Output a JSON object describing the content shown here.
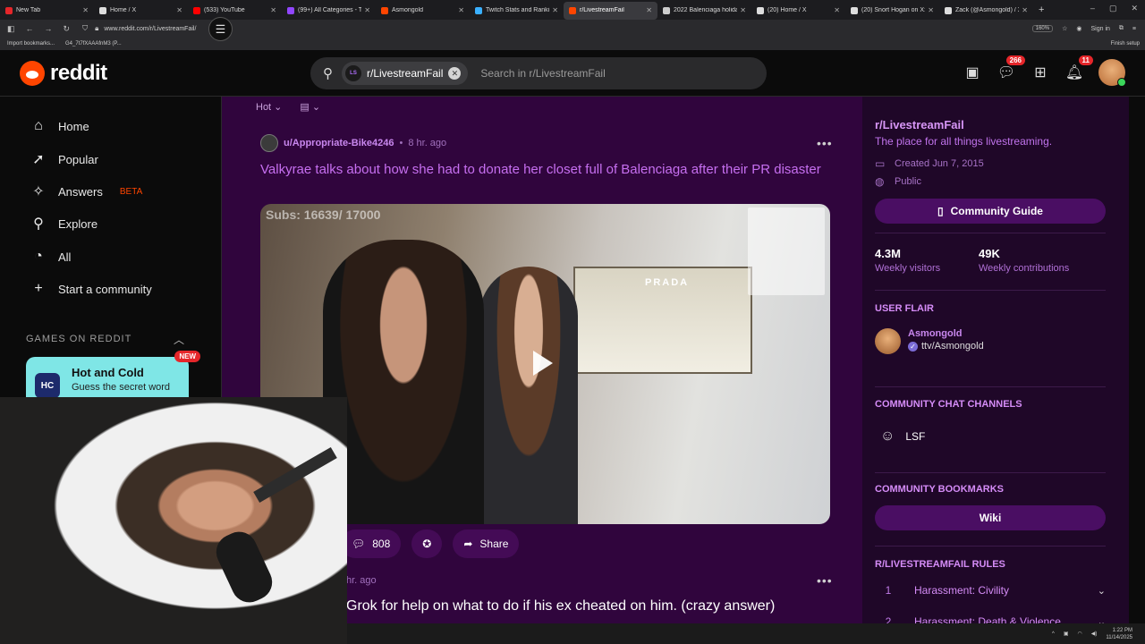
{
  "browser": {
    "tabs": [
      {
        "label": "New Tab",
        "color": "#e5262a"
      },
      {
        "label": "Home / X",
        "color": "#dddddd"
      },
      {
        "label": "(533) YouTube",
        "color": "#ff0000"
      },
      {
        "label": "(99+) All Categories - Twitch",
        "color": "#9146ff"
      },
      {
        "label": "Asmongold",
        "color": "#ff4500"
      },
      {
        "label": "Twitch Stats and Rankings",
        "color": "#3ab0ff"
      },
      {
        "label": "r/LivestreamFail",
        "color": "#ff4500",
        "active": true
      },
      {
        "label": "2022 Balenciaga holiday ad",
        "color": "#cccccc"
      },
      {
        "label": "(20) Home / X",
        "color": "#dddddd"
      },
      {
        "label": "(20) Snort Hogan on X: \"W",
        "color": "#dddddd"
      },
      {
        "label": "Zack (@Asmongold) / X",
        "color": "#dddddd"
      }
    ],
    "url": "www.reddit.com/r/LivestreamFail/",
    "zoom": "160%",
    "sign_in": "Sign in",
    "bookmarks": [
      "Import bookmarks...",
      "G4_7t7fXAAAfnM3 (P..."
    ],
    "finish_setup": "Finish setup"
  },
  "header": {
    "logo_text": "reddit",
    "search_chip": "r/LivestreamFail",
    "search_chip_avatar": "LS",
    "search_placeholder": "Search in r/LivestreamFail",
    "chat_badge": "266",
    "notif_badge": "11"
  },
  "leftnav": {
    "items": [
      {
        "label": "Home",
        "icon": "home-icon",
        "glyph": "⌂"
      },
      {
        "label": "Popular",
        "icon": "popular-icon",
        "glyph": "➚"
      },
      {
        "label": "Answers",
        "icon": "answers-icon",
        "glyph": "✧",
        "badge": "BETA"
      },
      {
        "label": "Explore",
        "icon": "explore-icon",
        "glyph": "⚲"
      },
      {
        "label": "All",
        "icon": "all-icon",
        "glyph": "◔"
      },
      {
        "label": "Start a community",
        "icon": "plus-icon",
        "glyph": "+"
      }
    ],
    "games_heading": "GAMES ON REDDIT",
    "game": {
      "title": "Hot and Cold",
      "subtitle": "Guess the secret word",
      "badge": "NEW",
      "icon_text": "HC"
    }
  },
  "feed": {
    "sort": "Hot",
    "post1": {
      "author": "u/Appropriate-Bike4246",
      "time": "8 hr. ago",
      "title": "Valkyrae talks about how she had to donate her closet full of Balenciaga after their PR disaster",
      "video_overlay": "Subs: 16639/ 17000",
      "store_sign": "PRADA",
      "comments": "808",
      "share": "Share"
    },
    "post2": {
      "time": "hr. ago",
      "title": "Grok for help on what to do if his ex cheated on him. (crazy answer)"
    }
  },
  "sidebar": {
    "name": "r/LivestreamFail",
    "description": "The place for all things livestreaming.",
    "created": "Created Jun 7, 2015",
    "visibility": "Public",
    "guide_button": "Community Guide",
    "stats": [
      {
        "value": "4.3M",
        "label": "Weekly visitors"
      },
      {
        "value": "49K",
        "label": "Weekly contributions"
      }
    ],
    "user_flair_heading": "USER FLAIR",
    "flair_user": "Asmongold",
    "flair_text": "ttv/Asmongold",
    "chat_heading": "COMMUNITY CHAT CHANNELS",
    "chat_channel": "LSF",
    "bookmarks_heading": "COMMUNITY BOOKMARKS",
    "wiki_button": "Wiki",
    "rules_heading": "R/LIVESTREAMFAIL RULES",
    "rules": [
      {
        "num": "1",
        "text": "Harassment: Civility"
      },
      {
        "num": "2",
        "text": "Harassment: Death & Violence"
      }
    ]
  },
  "taskbar": {
    "time": "1:22 PM",
    "date": "11/14/2025"
  },
  "colors": {
    "feed_bg": "#30053d",
    "accent": "#c66ff0",
    "reddit_orange": "#ff4500"
  }
}
